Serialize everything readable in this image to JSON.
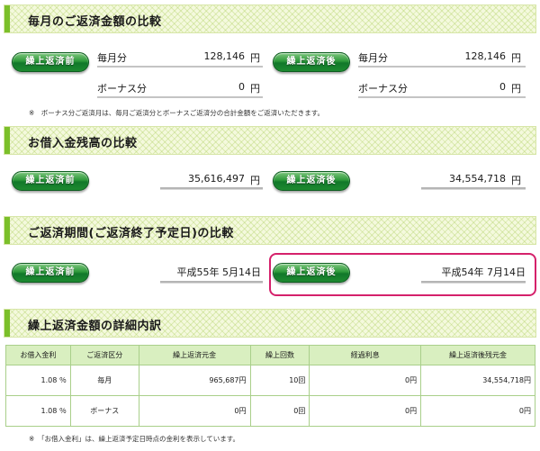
{
  "sections": {
    "monthly": {
      "title": "毎月のご返済金額の比較",
      "before_label": "繰上返済前",
      "after_label": "繰上返済後",
      "before": {
        "monthly_label": "毎月分",
        "monthly_value": "128,146",
        "monthly_unit": "円",
        "bonus_label": "ボーナス分",
        "bonus_value": "0",
        "bonus_unit": "円"
      },
      "after": {
        "monthly_label": "毎月分",
        "monthly_value": "128,146",
        "monthly_unit": "円",
        "bonus_label": "ボーナス分",
        "bonus_value": "0",
        "bonus_unit": "円"
      },
      "note": "※　ボーナス分ご返済月は、毎月ご返済分とボーナスご返済分の合計金額をご返済いただきます。"
    },
    "balance": {
      "title": "お借入金残高の比較",
      "before_label": "繰上返済前",
      "after_label": "繰上返済後",
      "before_value": "35,616,497",
      "before_unit": "円",
      "after_value": "34,554,718",
      "after_unit": "円"
    },
    "period": {
      "title": "ご返済期間(ご返済終了予定日)の比較",
      "before_label": "繰上返済前",
      "after_label": "繰上返済後",
      "before_value": "平成55年 5月14日",
      "after_value": "平成54年 7月14日"
    },
    "detail": {
      "title": "繰上返済金額の詳細内訳",
      "headers": [
        "お借入金利",
        "ご返済区分",
        "繰上返済元金",
        "繰上回数",
        "経過利息",
        "繰上返済後残元金"
      ],
      "rows": [
        [
          "1.08 ％",
          "毎月",
          "965,687円",
          "10回",
          "0円",
          "34,554,718円"
        ],
        [
          "1.08 ％",
          "ボーナス",
          "0円",
          "0回",
          "0円",
          "0円"
        ]
      ],
      "note": "※　「お借入金利」は、繰上返済予定日時点の金利を表示しています。"
    }
  },
  "colors": {
    "accent_green": "#7bbf2a",
    "button_green": "#1d8a30",
    "highlight_pink": "#d5216b",
    "table_header_bg": "#d9efc0"
  }
}
